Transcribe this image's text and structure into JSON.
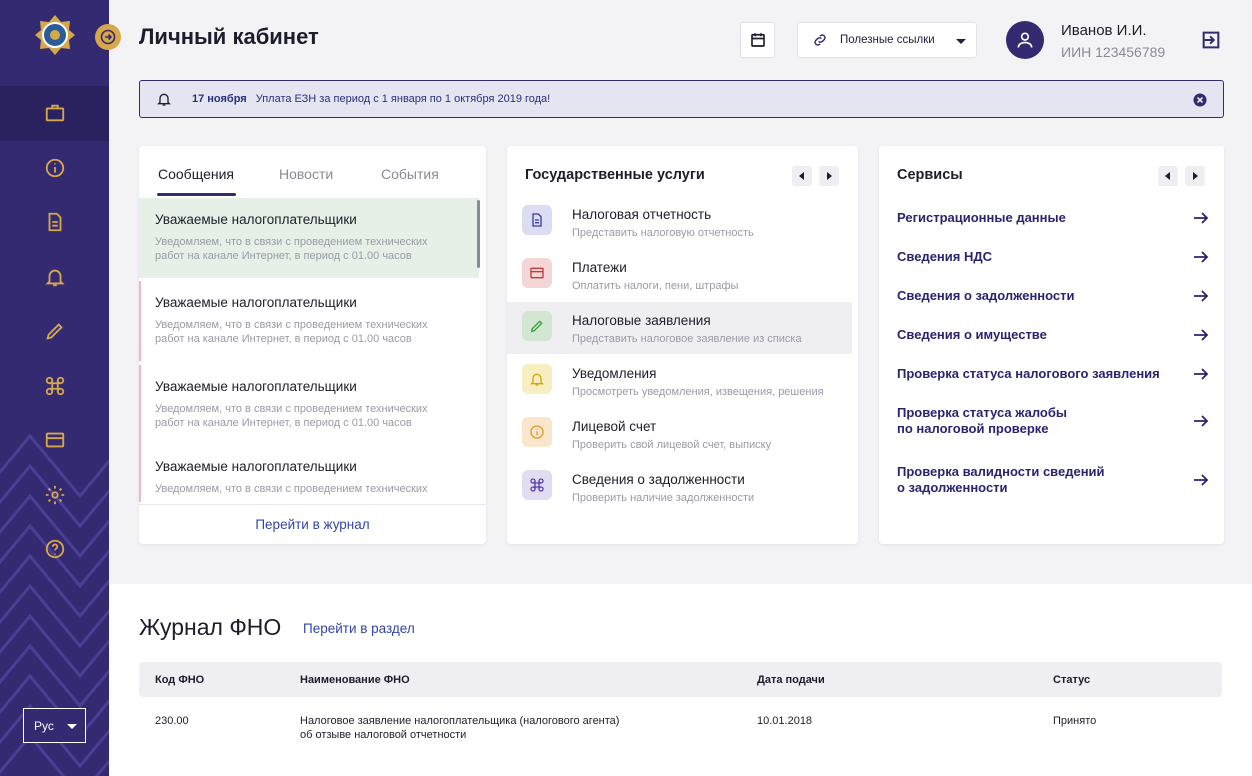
{
  "header": {
    "title": "Личный кабинет",
    "links_label": "Полезные ссылки",
    "user_name": "Иванов И.И.",
    "user_iin": "ИИН 123456789"
  },
  "notice": {
    "date": "17 ноября",
    "text": "Уплата ЕЗН за период с 1 января по 1 октября 2019 года!"
  },
  "sidebar": {
    "items": [
      "briefcase-icon",
      "info-icon",
      "document-icon",
      "bell-icon",
      "pencil-icon",
      "command-icon",
      "card-icon",
      "gear-icon",
      "help-icon"
    ],
    "language": "Рус"
  },
  "messages": {
    "tabs": [
      "Сообщения",
      "Новости",
      "События"
    ],
    "items": [
      {
        "title": "Уважаемые налогоплательщики",
        "line1": "Уведомляем, что в связи с проведением технических",
        "line2": " работ на канале Интернет, в период с 01.00 часов"
      },
      {
        "title": "Уважаемые налогоплательщики",
        "line1": "Уведомляем, что в связи с проведением технических",
        "line2": " работ на канале Интернет, в период с 01.00 часов"
      },
      {
        "title": "Уважаемые налогоплательщики",
        "line1": "Уведомляем, что в связи с проведением технических",
        "line2": " работ на канале Интернет, в период с 01.00 часов"
      },
      {
        "title": "Уважаемые налогоплательщики",
        "line1": "Уведомляем, что в связи с проведением технических",
        "line2": ""
      }
    ],
    "journal_link": "Перейти в журнал"
  },
  "gov": {
    "title": "Государственные услуги",
    "items": [
      {
        "name": "Налоговая отчетность",
        "sub": "Представить налоговую отчетность",
        "color": "#dcdcf2",
        "fg": "#3a3aa0"
      },
      {
        "name": "Платежи",
        "sub": "Оплатить налоги, пени, штрафы",
        "color": "#f5d6d6",
        "fg": "#c73838"
      },
      {
        "name": "Налоговые заявления",
        "sub": "Представить налоговое заявление из списка",
        "color": "#d2e6d2",
        "fg": "#3f9a3f"
      },
      {
        "name": "Уведомления",
        "sub": "Просмотреть уведомления, извещения, решения",
        "color": "#f7eec2",
        "fg": "#d4a800"
      },
      {
        "name": "Лицевой счет",
        "sub": "Проверить свой лицевой счет, выписку",
        "color": "#fae6cc",
        "fg": "#e09a2a"
      },
      {
        "name": "Сведения о задолженности",
        "sub": "Проверить наличие задолженности",
        "color": "#e2dcf2",
        "fg": "#5a3fb0"
      }
    ]
  },
  "services": {
    "title": "Сервисы",
    "items": [
      {
        "l1": "Регистрационные данные",
        "l2": ""
      },
      {
        "l1": "Сведения НДС",
        "l2": ""
      },
      {
        "l1": "Сведения о задолженности",
        "l2": ""
      },
      {
        "l1": "Сведения о имуществе",
        "l2": ""
      },
      {
        "l1": "Проверка статуса налогового заявления",
        "l2": ""
      },
      {
        "l1": "Проверка статуса жалобы",
        "l2": "по налоговой проверке"
      },
      {
        "l1": "Проверка валидности сведений",
        "l2": "о задолженности"
      }
    ]
  },
  "journal": {
    "title": "Журнал ФНО",
    "link": "Перейти в раздел",
    "columns": [
      "Код ФНО",
      "Наименование  ФНО",
      "Дата подачи",
      "Статус"
    ],
    "rows": [
      {
        "code": "230.00",
        "name1": "Налоговое заявление налогоплательщика (налогового агента)",
        "name2": "об отзыве налоговой отчетности",
        "date": "10.01.2018",
        "status": "Принято"
      }
    ]
  },
  "colors": {
    "sidebar": "#332a72",
    "accent": "#d7a84a",
    "link": "#3344a8"
  }
}
